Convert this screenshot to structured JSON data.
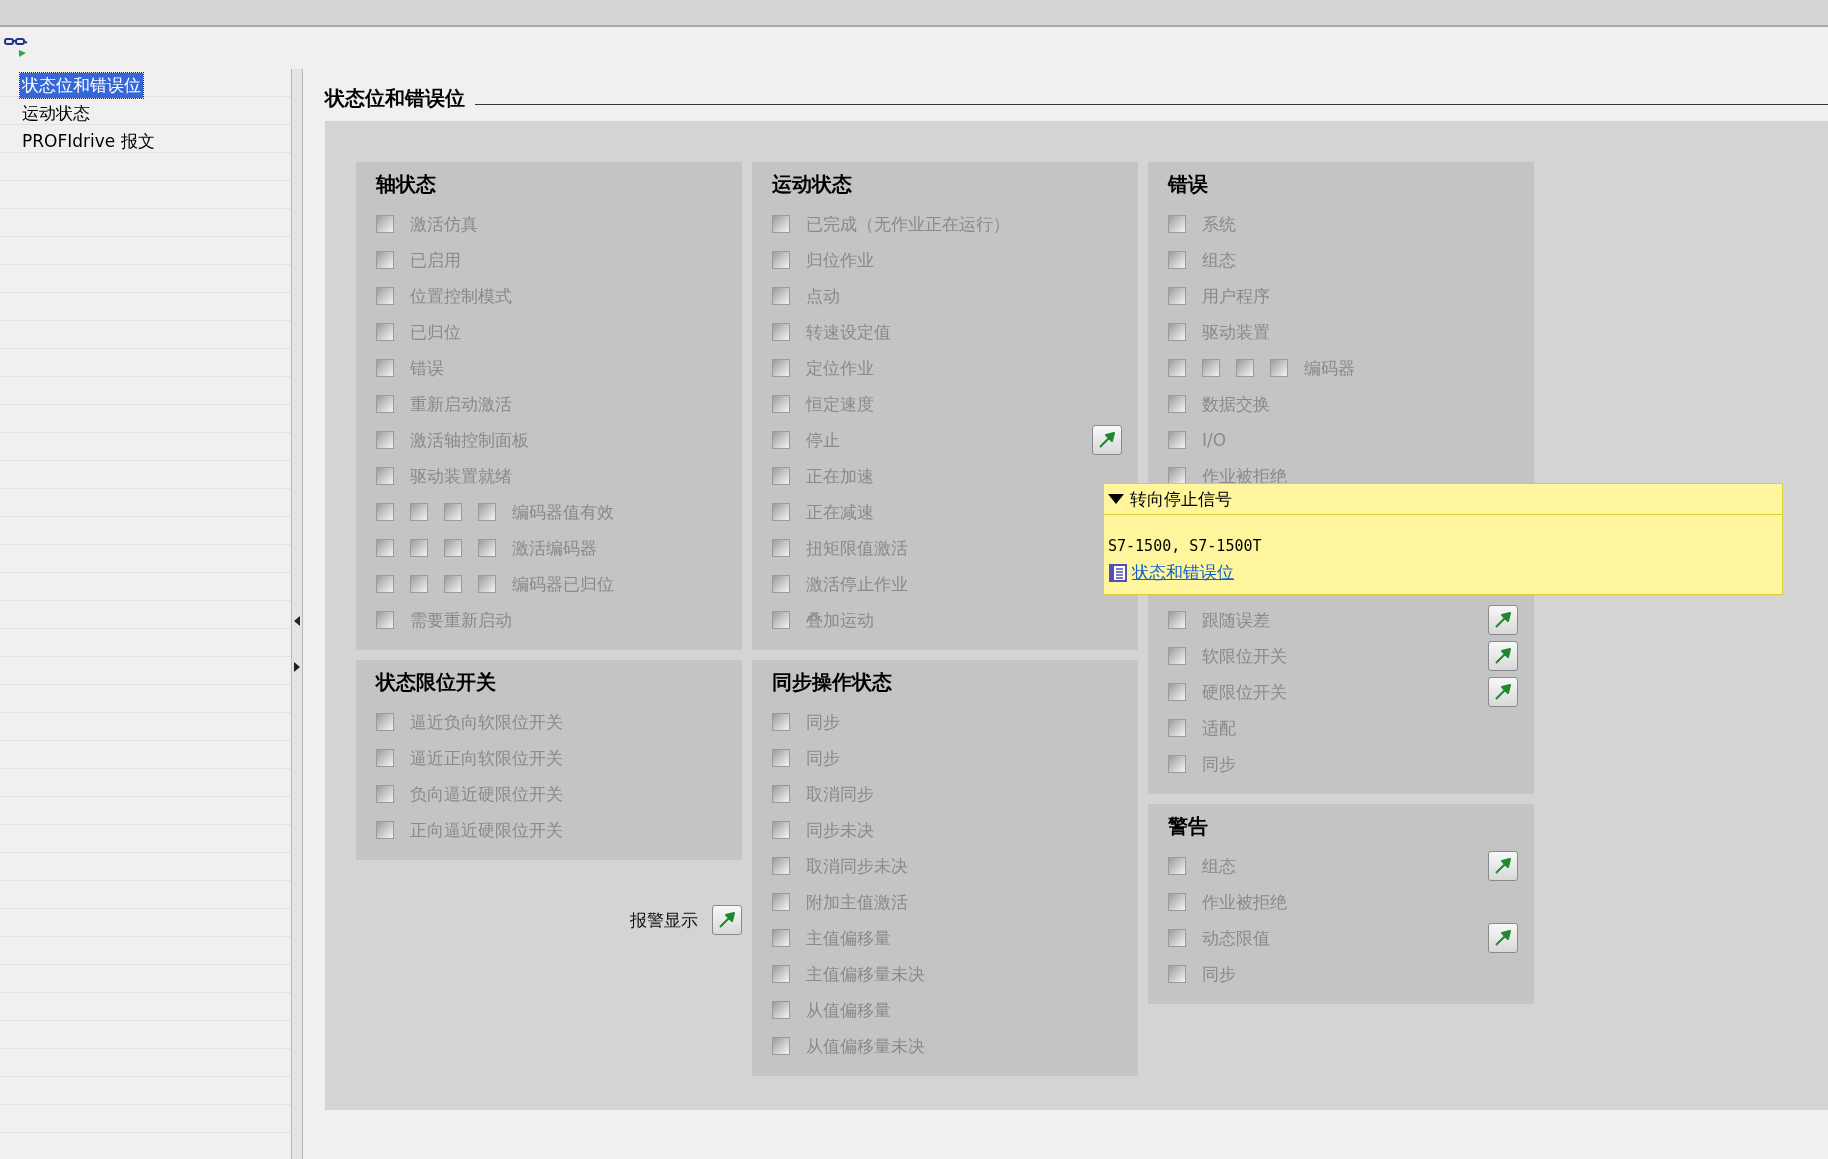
{
  "sidebar": {
    "items": [
      {
        "label": "状态位和错误位",
        "selected": true
      },
      {
        "label": "运动状态",
        "selected": false
      },
      {
        "label": "PROFIdrive 报文",
        "selected": false
      }
    ]
  },
  "title": "状态位和错误位",
  "columns": [
    {
      "panels": [
        {
          "title": "轴状态",
          "rows": [
            {
              "kind": "single",
              "label": "激活仿真",
              "checked": false,
              "jump": false
            },
            {
              "kind": "single",
              "label": "已启用",
              "checked": false,
              "jump": false
            },
            {
              "kind": "single",
              "label": "位置控制模式",
              "checked": false,
              "jump": false
            },
            {
              "kind": "single",
              "label": "已归位",
              "checked": false,
              "jump": false
            },
            {
              "kind": "single",
              "label": "错误",
              "checked": false,
              "jump": false
            },
            {
              "kind": "single",
              "label": "重新启动激活",
              "checked": false,
              "jump": false
            },
            {
              "kind": "single",
              "label": "激活轴控制面板",
              "checked": false,
              "jump": false
            },
            {
              "kind": "single",
              "label": "驱动装置就绪",
              "checked": false,
              "jump": false
            },
            {
              "kind": "multi",
              "label": "编码器值有效",
              "checkboxes": [
                {
                  "checked": false
                },
                {
                  "checked": false
                },
                {
                  "checked": false
                },
                {
                  "checked": false
                }
              ],
              "jump": false
            },
            {
              "kind": "multi",
              "label": "激活编码器",
              "checkboxes": [
                {
                  "checked": false
                },
                {
                  "checked": false
                },
                {
                  "checked": false
                },
                {
                  "checked": false
                }
              ],
              "jump": false
            },
            {
              "kind": "multi",
              "label": "编码器已归位",
              "checkboxes": [
                {
                  "checked": false
                },
                {
                  "checked": false
                },
                {
                  "checked": false
                },
                {
                  "checked": false
                }
              ],
              "jump": false
            },
            {
              "kind": "single",
              "label": "需要重新启动",
              "checked": false,
              "jump": false
            }
          ]
        },
        {
          "title": "状态限位开关",
          "rows": [
            {
              "kind": "single",
              "label": "逼近负向软限位开关",
              "checked": false,
              "jump": false
            },
            {
              "kind": "single",
              "label": "逼近正向软限位开关",
              "checked": false,
              "jump": false
            },
            {
              "kind": "single",
              "label": "负向逼近硬限位开关",
              "checked": false,
              "jump": false
            },
            {
              "kind": "single",
              "label": "正向逼近硬限位开关",
              "checked": false,
              "jump": false
            }
          ]
        }
      ],
      "alarm_display": {
        "label": "报警显示"
      }
    },
    {
      "panels": [
        {
          "title": "运动状态",
          "rows": [
            {
              "kind": "single",
              "label": "已完成（无作业正在运行）",
              "checked": false,
              "jump": false
            },
            {
              "kind": "single",
              "label": "归位作业",
              "checked": false,
              "jump": false
            },
            {
              "kind": "single",
              "label": "点动",
              "checked": false,
              "jump": false
            },
            {
              "kind": "single",
              "label": "转速设定值",
              "checked": false,
              "jump": false
            },
            {
              "kind": "single",
              "label": "定位作业",
              "checked": false,
              "jump": false
            },
            {
              "kind": "single",
              "label": "恒定速度",
              "checked": false,
              "jump": false
            },
            {
              "kind": "single",
              "label": "停止",
              "checked": false,
              "jump": true
            },
            {
              "kind": "single",
              "label": "正在加速",
              "checked": false,
              "jump": false
            },
            {
              "kind": "single",
              "label": "正在减速",
              "checked": false,
              "jump": false
            },
            {
              "kind": "single",
              "label": "扭矩限值激活",
              "checked": false,
              "jump": false
            },
            {
              "kind": "single",
              "label": "激活停止作业",
              "checked": false,
              "jump": false
            },
            {
              "kind": "single",
              "label": "叠加运动",
              "checked": false,
              "jump": false
            }
          ]
        },
        {
          "title": "同步操作状态",
          "rows": [
            {
              "kind": "single",
              "label": "同步",
              "checked": false,
              "jump": false
            },
            {
              "kind": "single",
              "label": "同步",
              "checked": false,
              "jump": false
            },
            {
              "kind": "single",
              "label": "取消同步",
              "checked": false,
              "jump": false
            },
            {
              "kind": "single",
              "label": "同步未决",
              "checked": false,
              "jump": false
            },
            {
              "kind": "single",
              "label": "取消同步未决",
              "checked": false,
              "jump": false
            },
            {
              "kind": "single",
              "label": "附加主值激活",
              "checked": false,
              "jump": false
            },
            {
              "kind": "single",
              "label": "主值偏移量",
              "checked": false,
              "jump": false
            },
            {
              "kind": "single",
              "label": "主值偏移量未决",
              "checked": false,
              "jump": false
            },
            {
              "kind": "single",
              "label": "从值偏移量",
              "checked": false,
              "jump": false
            },
            {
              "kind": "single",
              "label": "从值偏移量未决",
              "checked": false,
              "jump": false
            }
          ]
        }
      ]
    },
    {
      "panels": [
        {
          "title": "错误",
          "rows": [
            {
              "kind": "single",
              "label": "系统",
              "checked": false,
              "jump": false
            },
            {
              "kind": "single",
              "label": "组态",
              "checked": false,
              "jump": false
            },
            {
              "kind": "single",
              "label": "用户程序",
              "checked": false,
              "jump": false
            },
            {
              "kind": "single",
              "label": "驱动装置",
              "checked": false,
              "jump": false
            },
            {
              "kind": "multi",
              "label": "编码器",
              "checkboxes": [
                {
                  "checked": false
                },
                {
                  "checked": false
                },
                {
                  "checked": false
                },
                {
                  "checked": false
                }
              ],
              "jump": false
            },
            {
              "kind": "single",
              "label": "数据交换",
              "checked": false,
              "jump": false
            },
            {
              "kind": "single",
              "label": "I/O",
              "checked": false,
              "jump": false
            },
            {
              "kind": "single",
              "label": "作业被拒绝",
              "checked": false,
              "jump": false
            },
            {
              "kind": "gap"
            },
            {
              "kind": "gap"
            },
            {
              "kind": "gap"
            },
            {
              "kind": "single",
              "label": "跟随误差",
              "checked": false,
              "jump": true
            },
            {
              "kind": "single",
              "label": "软限位开关",
              "checked": false,
              "jump": true
            },
            {
              "kind": "single",
              "label": "硬限位开关",
              "checked": false,
              "jump": true
            },
            {
              "kind": "single",
              "label": "适配",
              "checked": false,
              "jump": false
            },
            {
              "kind": "single",
              "label": "同步",
              "checked": false,
              "jump": false
            }
          ]
        },
        {
          "title": "警告",
          "rows": [
            {
              "kind": "single",
              "label": "组态",
              "checked": false,
              "jump": true
            },
            {
              "kind": "single",
              "label": "作业被拒绝",
              "checked": false,
              "jump": false
            },
            {
              "kind": "single",
              "label": "动态限值",
              "checked": false,
              "jump": true
            },
            {
              "kind": "single",
              "label": "同步",
              "checked": false,
              "jump": false
            }
          ]
        }
      ]
    }
  ],
  "tooltip": {
    "title": "转向停止信号",
    "expanded": true,
    "devices": "S7-1500, S7-1500T",
    "link": "状态和错误位"
  }
}
